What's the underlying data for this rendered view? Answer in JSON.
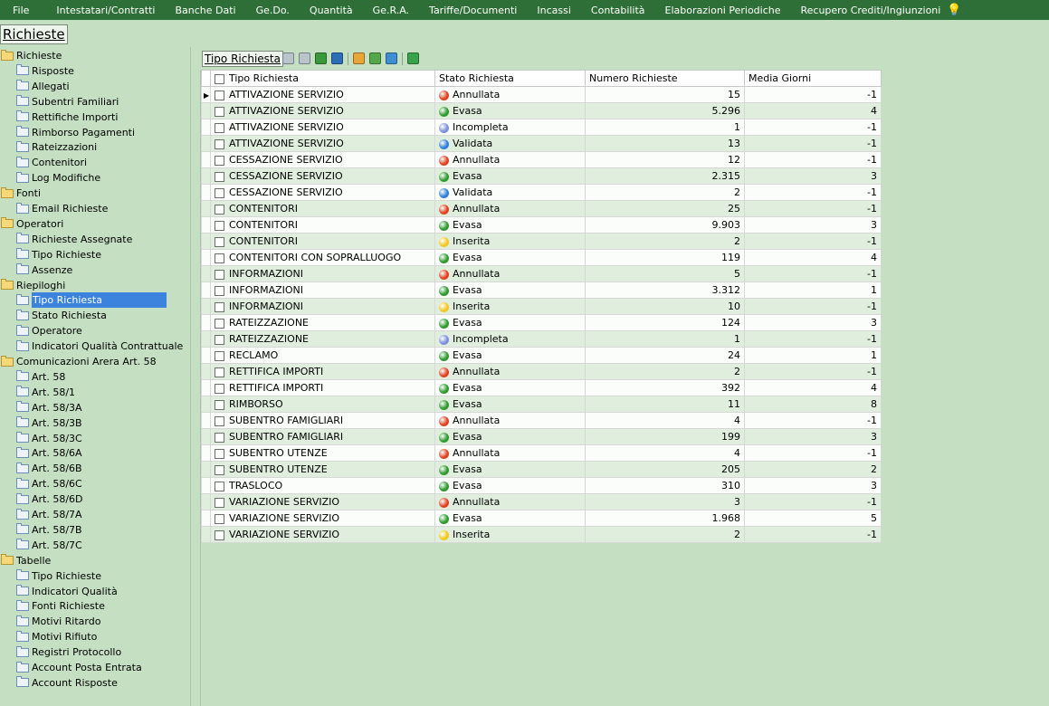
{
  "menu": [
    {
      "label": "File"
    },
    {
      "label": "Intestatari/Contratti"
    },
    {
      "label": "Banche Dati"
    },
    {
      "label": "Ge.Do."
    },
    {
      "label": "Quantità"
    },
    {
      "label": "Ge.R.A."
    },
    {
      "label": "Tariffe/Documenti"
    },
    {
      "label": "Incassi"
    },
    {
      "label": "Contabilità"
    },
    {
      "label": "Elaborazioni Periodiche"
    },
    {
      "label": "Recupero Crediti/Ingiunzioni"
    }
  ],
  "page_title": "Richieste",
  "tree": [
    {
      "label": "Richieste",
      "level": 0,
      "open": true
    },
    {
      "label": "Risposte",
      "level": 1
    },
    {
      "label": "Allegati",
      "level": 1
    },
    {
      "label": "Subentri Familiari",
      "level": 1
    },
    {
      "label": "Rettifiche Importi",
      "level": 1
    },
    {
      "label": "Rimborso Pagamenti",
      "level": 1
    },
    {
      "label": "Rateizzazioni",
      "level": 1
    },
    {
      "label": "Contenitori",
      "level": 1
    },
    {
      "label": "Log Modifiche",
      "level": 1
    },
    {
      "label": "Fonti",
      "level": 0,
      "open": true
    },
    {
      "label": "Email Richieste",
      "level": 1
    },
    {
      "label": "Operatori",
      "level": 0,
      "open": true
    },
    {
      "label": "Richieste Assegnate",
      "level": 1
    },
    {
      "label": "Tipo Richieste",
      "level": 1
    },
    {
      "label": "Assenze",
      "level": 1
    },
    {
      "label": "Riepiloghi",
      "level": 0,
      "open": true
    },
    {
      "label": "Tipo Richiesta",
      "level": 1,
      "selected": true
    },
    {
      "label": "Stato Richiesta",
      "level": 1
    },
    {
      "label": "Operatore",
      "level": 1
    },
    {
      "label": "Indicatori Qualità Contrattuale",
      "level": 1
    },
    {
      "label": "Comunicazioni Arera Art. 58",
      "level": 0,
      "open": true
    },
    {
      "label": "Art. 58",
      "level": 1
    },
    {
      "label": "Art. 58/1",
      "level": 1
    },
    {
      "label": "Art. 58/3A",
      "level": 1
    },
    {
      "label": "Art. 58/3B",
      "level": 1
    },
    {
      "label": "Art. 58/3C",
      "level": 1
    },
    {
      "label": "Art. 58/6A",
      "level": 1
    },
    {
      "label": "Art. 58/6B",
      "level": 1
    },
    {
      "label": "Art. 58/6C",
      "level": 1
    },
    {
      "label": "Art. 58/6D",
      "level": 1
    },
    {
      "label": "Art. 58/7A",
      "level": 1
    },
    {
      "label": "Art. 58/7B",
      "level": 1
    },
    {
      "label": "Art. 58/7C",
      "level": 1
    },
    {
      "label": "Tabelle",
      "level": 0,
      "open": true
    },
    {
      "label": "Tipo Richieste",
      "level": 1
    },
    {
      "label": "Indicatori Qualità",
      "level": 1
    },
    {
      "label": "Fonti Richieste",
      "level": 1
    },
    {
      "label": "Motivi Ritardo",
      "level": 1
    },
    {
      "label": "Motivi Rifiuto",
      "level": 1
    },
    {
      "label": "Registri Protocollo",
      "level": 1
    },
    {
      "label": "Account Posta Entrata",
      "level": 1
    },
    {
      "label": "Account Risposte",
      "level": 1
    }
  ],
  "grid_title": "Tipo Richiesta",
  "toolbar": [
    {
      "icon": "first-record-icon",
      "color": "#b9c4cc"
    },
    {
      "icon": "previous-record-icon",
      "color": "#b9c4cc"
    },
    {
      "icon": "next-record-icon",
      "color": "#3a9a3a"
    },
    {
      "icon": "last-record-icon",
      "color": "#2c6fb7"
    },
    {
      "sep": true
    },
    {
      "icon": "edit-icon",
      "color": "#e9a43a"
    },
    {
      "icon": "add-icon",
      "color": "#55a84a"
    },
    {
      "icon": "export-icon",
      "color": "#3d8fd1"
    },
    {
      "sep": true
    },
    {
      "icon": "refresh-icon",
      "color": "#3aa24a"
    }
  ],
  "columns": [
    "Tipo Richiesta",
    "Stato Richiesta",
    "Numero Richieste",
    "Media Giorni"
  ],
  "status_colors": {
    "Annullata": "#e0421f",
    "Evasa": "#2e9b2e",
    "Incompleta": "#7d8fdc",
    "Validata": "#2f7fd6",
    "Inserita": "#f2c81e"
  },
  "rows": [
    {
      "tipo": "ATTIVAZIONE SERVIZIO",
      "stato": "Annullata",
      "numero": "15",
      "media": "-1"
    },
    {
      "tipo": "ATTIVAZIONE SERVIZIO",
      "stato": "Evasa",
      "numero": "5.296",
      "media": "4"
    },
    {
      "tipo": "ATTIVAZIONE SERVIZIO",
      "stato": "Incompleta",
      "numero": "1",
      "media": "-1"
    },
    {
      "tipo": "ATTIVAZIONE SERVIZIO",
      "stato": "Validata",
      "numero": "13",
      "media": "-1"
    },
    {
      "tipo": "CESSAZIONE SERVIZIO",
      "stato": "Annullata",
      "numero": "12",
      "media": "-1"
    },
    {
      "tipo": "CESSAZIONE SERVIZIO",
      "stato": "Evasa",
      "numero": "2.315",
      "media": "3"
    },
    {
      "tipo": "CESSAZIONE SERVIZIO",
      "stato": "Validata",
      "numero": "2",
      "media": "-1"
    },
    {
      "tipo": "CONTENITORI",
      "stato": "Annullata",
      "numero": "25",
      "media": "-1"
    },
    {
      "tipo": "CONTENITORI",
      "stato": "Evasa",
      "numero": "9.903",
      "media": "3"
    },
    {
      "tipo": "CONTENITORI",
      "stato": "Inserita",
      "numero": "2",
      "media": "-1"
    },
    {
      "tipo": "CONTENITORI CON SOPRALLUOGO",
      "stato": "Evasa",
      "numero": "119",
      "media": "4"
    },
    {
      "tipo": "INFORMAZIONI",
      "stato": "Annullata",
      "numero": "5",
      "media": "-1"
    },
    {
      "tipo": "INFORMAZIONI",
      "stato": "Evasa",
      "numero": "3.312",
      "media": "1"
    },
    {
      "tipo": "INFORMAZIONI",
      "stato": "Inserita",
      "numero": "10",
      "media": "-1"
    },
    {
      "tipo": "RATEIZZAZIONE",
      "stato": "Evasa",
      "numero": "124",
      "media": "3"
    },
    {
      "tipo": "RATEIZZAZIONE",
      "stato": "Incompleta",
      "numero": "1",
      "media": "-1"
    },
    {
      "tipo": "RECLAMO",
      "stato": "Evasa",
      "numero": "24",
      "media": "1"
    },
    {
      "tipo": "RETTIFICA IMPORTI",
      "stato": "Annullata",
      "numero": "2",
      "media": "-1"
    },
    {
      "tipo": "RETTIFICA IMPORTI",
      "stato": "Evasa",
      "numero": "392",
      "media": "4"
    },
    {
      "tipo": "RIMBORSO",
      "stato": "Evasa",
      "numero": "11",
      "media": "8"
    },
    {
      "tipo": "SUBENTRO FAMIGLIARI",
      "stato": "Annullata",
      "numero": "4",
      "media": "-1"
    },
    {
      "tipo": "SUBENTRO FAMIGLIARI",
      "stato": "Evasa",
      "numero": "199",
      "media": "3"
    },
    {
      "tipo": "SUBENTRO UTENZE",
      "stato": "Annullata",
      "numero": "4",
      "media": "-1"
    },
    {
      "tipo": "SUBENTRO UTENZE",
      "stato": "Evasa",
      "numero": "205",
      "media": "2"
    },
    {
      "tipo": "TRASLOCO",
      "stato": "Evasa",
      "numero": "310",
      "media": "3"
    },
    {
      "tipo": "VARIAZIONE SERVIZIO",
      "stato": "Annullata",
      "numero": "3",
      "media": "-1"
    },
    {
      "tipo": "VARIAZIONE SERVIZIO",
      "stato": "Evasa",
      "numero": "1.968",
      "media": "5"
    },
    {
      "tipo": "VARIAZIONE SERVIZIO",
      "stato": "Inserita",
      "numero": "2",
      "media": "-1"
    }
  ]
}
